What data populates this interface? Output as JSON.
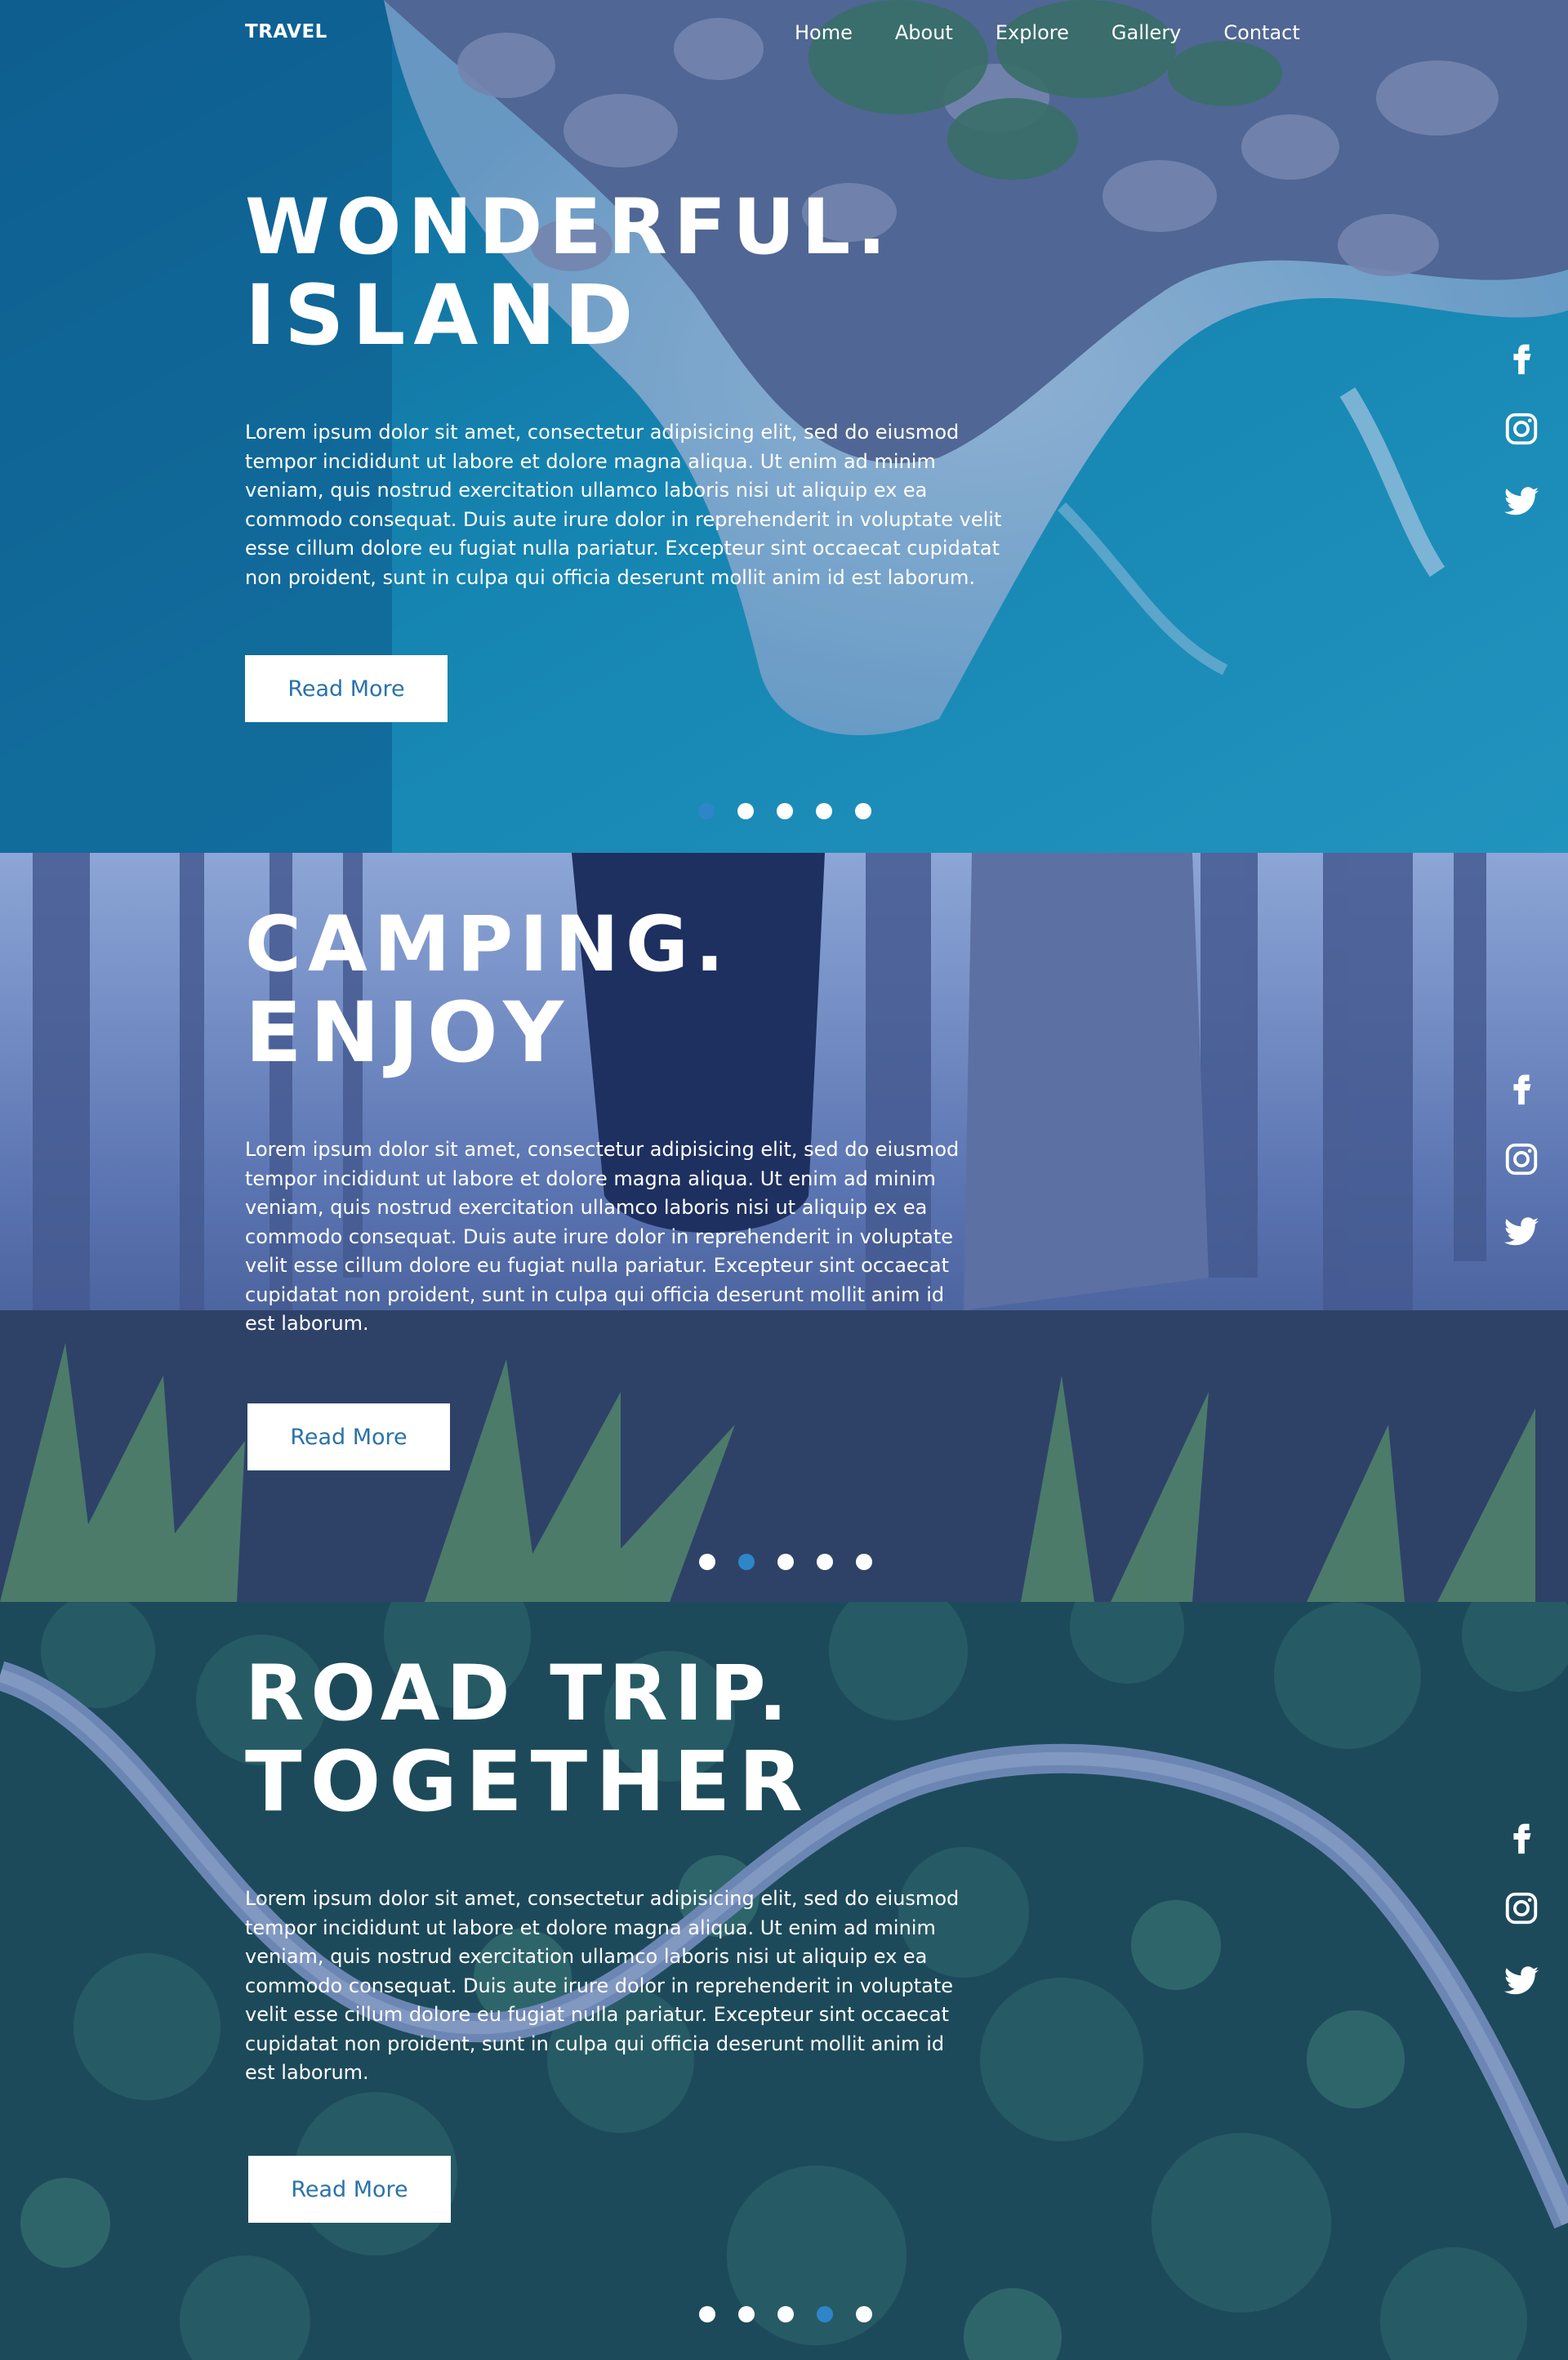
{
  "nav": {
    "logo": "TRAVEL",
    "items": [
      {
        "label": "Home"
      },
      {
        "label": "About"
      },
      {
        "label": "Explore"
      },
      {
        "label": "Gallery"
      },
      {
        "label": "Contact"
      }
    ]
  },
  "slides": [
    {
      "title_line1": "WONDERFUL.",
      "title_line2": "ISLAND",
      "paragraph": "Lorem ipsum dolor sit amet, consectetur adipisicing elit, sed do eiusmod tempor incididunt ut labore et dolore magna aliqua. Ut enim ad minim veniam, quis nostrud exercitation ullamco laboris nisi ut aliquip ex ea commodo consequat. Duis aute irure dolor in reprehenderit in voluptate velit esse cillum dolore eu fugiat nulla pariatur. Excepteur sint occaecat cupidatat non proident, sunt in culpa qui officia deserunt mollit anim id est laborum.",
      "button": "Read More",
      "active_dot": 0
    },
    {
      "title_line1": "CAMPING.",
      "title_line2": "ENJOY",
      "paragraph": "Lorem ipsum dolor sit amet, consectetur adipisicing elit, sed do eiusmod tempor incididunt ut labore et dolore magna aliqua. Ut enim ad minim veniam, quis nostrud exercitation ullamco laboris nisi ut aliquip ex ea commodo consequat. Duis aute irure dolor in reprehenderit in voluptate velit esse cillum dolore eu fugiat nulla pariatur. Excepteur sint occaecat cupidatat non proident, sunt in culpa qui officia deserunt mollit anim id est laborum.",
      "button": "Read More",
      "active_dot": 1
    },
    {
      "title_line1": "ROAD TRIP.",
      "title_line2": "TOGETHER",
      "paragraph": "Lorem ipsum dolor sit amet, consectetur adipisicing elit, sed do eiusmod tempor incididunt ut labore et dolore magna aliqua. Ut enim ad minim veniam, quis nostrud exercitation ullamco laboris nisi ut aliquip ex ea commodo consequat. Duis aute irure dolor in reprehenderit in voluptate velit esse cillum dolore eu fugiat nulla pariatur. Excepteur sint occaecat cupidatat non proident, sunt in culpa qui officia deserunt mollit anim id est laborum.",
      "button": "Read More",
      "active_dot": 3
    }
  ],
  "social_icons": [
    "facebook-icon",
    "instagram-icon",
    "twitter-icon"
  ],
  "colors": {
    "accent_dot": "#2e86c9",
    "button_text": "#2a73a9",
    "overlay": "#1e4b9a"
  }
}
